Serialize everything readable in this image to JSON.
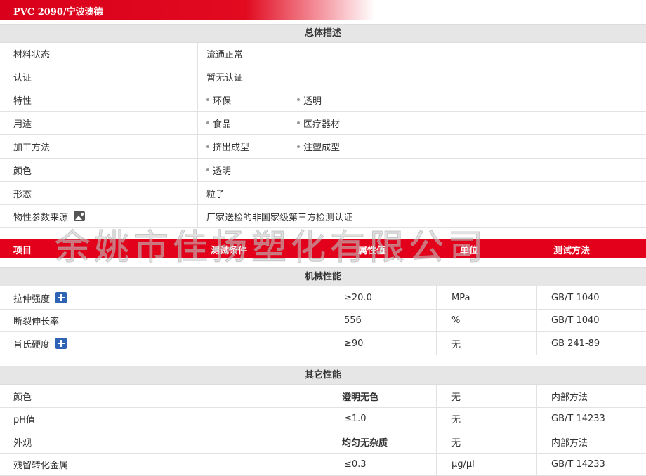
{
  "title": "PVC 2090/宁波澳德",
  "overview": {
    "heading": "总体描述",
    "rows": [
      {
        "label": "材料状态",
        "value": "流通正常"
      },
      {
        "label": "认证",
        "value": "暂无认证"
      },
      {
        "label": "特性",
        "items": [
          "环保",
          "透明"
        ]
      },
      {
        "label": "用途",
        "items": [
          "食品",
          "医疗器材"
        ]
      },
      {
        "label": "加工方法",
        "items": [
          "挤出成型",
          "注塑成型"
        ]
      },
      {
        "label": "颜色",
        "items": [
          "透明"
        ]
      },
      {
        "label": "形态",
        "value": "粒子"
      },
      {
        "label": "物性参数来源",
        "value": "厂家送检的非国家级第三方检测认证",
        "icon": "photo-icon"
      }
    ]
  },
  "watermark": "余姚市佳扬塑化有限公司",
  "columns": [
    "项目",
    "测试条件",
    "属性值",
    "单位",
    "测试方法"
  ],
  "mechanical": {
    "heading": "机械性能",
    "rows": [
      {
        "item": "拉伸强度",
        "condition": "",
        "value": "≥20.0",
        "unit": "MPa",
        "method": "GB/T 1040",
        "icon": "plus-icon"
      },
      {
        "item": "断裂伸长率",
        "condition": "",
        "value": "556",
        "unit": "%",
        "method": "GB/T 1040"
      },
      {
        "item": "肖氏硬度",
        "condition": "",
        "value": "≥90",
        "unit": "无",
        "method": "GB 241-89",
        "icon": "plus-icon"
      }
    ]
  },
  "other": {
    "heading": "其它性能",
    "rows": [
      {
        "item": "颜色",
        "condition": "",
        "value": "澄明无色",
        "unit": "无",
        "method": "内部方法"
      },
      {
        "item": "pH值",
        "condition": "",
        "value": "≤1.0",
        "unit": "无",
        "method": "GB/T 14233"
      },
      {
        "item": "外观",
        "condition": "",
        "value": "均匀无杂质",
        "unit": "无",
        "method": "内部方法"
      },
      {
        "item": "残留转化金属",
        "condition": "",
        "value": "≤0.3",
        "unit": "μg/μl",
        "method": "GB/T 14233"
      }
    ]
  }
}
